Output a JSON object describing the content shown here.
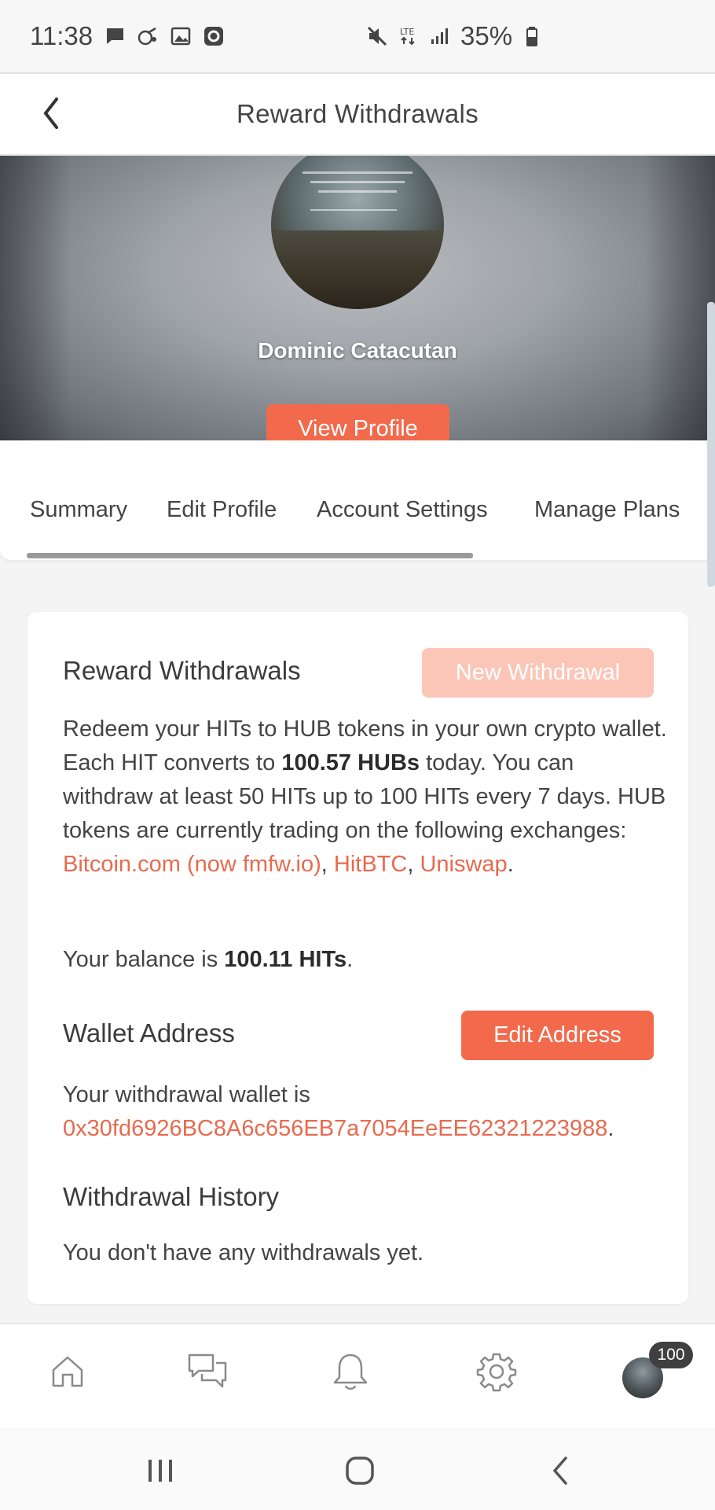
{
  "status_bar": {
    "time": "11:38",
    "battery": "35%"
  },
  "header": {
    "title": "Reward Withdrawals"
  },
  "profile": {
    "name": "Dominic Catacutan",
    "view_profile_label": "View Profile"
  },
  "tabs": [
    {
      "label": "Summary"
    },
    {
      "label": "Edit Profile"
    },
    {
      "label": "Account Settings"
    },
    {
      "label": "Manage Plans"
    }
  ],
  "card": {
    "title": "Reward Withdrawals",
    "new_withdrawal_label": "New Withdrawal",
    "intro": {
      "p1": "Redeem your HITs to HUB tokens in your own crypto wallet. Each HIT converts to ",
      "rate": "100.57 HUBs",
      "p2": " today. You can withdraw at least 50 HITs up to 100 HITs every 7 days. HUB tokens are currently trading on the following exchanges: ",
      "exchanges": [
        "Bitcoin.com (now fmfw.io)",
        "HitBTC",
        "Uniswap"
      ],
      "sep1": ", ",
      "sep2": ", ",
      "end": "."
    },
    "balance": {
      "prefix": "Your balance is ",
      "value": "100.11 HITs",
      "suffix": "."
    },
    "wallet": {
      "title": "Wallet Address",
      "edit_label": "Edit Address",
      "prefix": "Your withdrawal wallet is",
      "address": "0x30fd6926BC8A6c656EB7a7054EeEE62321223988",
      "suffix": "."
    },
    "history": {
      "title": "Withdrawal History",
      "empty_text": "You don't have any withdrawals yet."
    }
  },
  "bottom_nav": {
    "items": [
      {
        "icon": "home-icon"
      },
      {
        "icon": "chat-icon"
      },
      {
        "icon": "bell-icon"
      },
      {
        "icon": "gear-icon"
      }
    ],
    "badge": "100"
  },
  "colors": {
    "accent": "#f26a4b",
    "accent_disabled": "#fbc6b8",
    "link": "#e86a4e"
  }
}
